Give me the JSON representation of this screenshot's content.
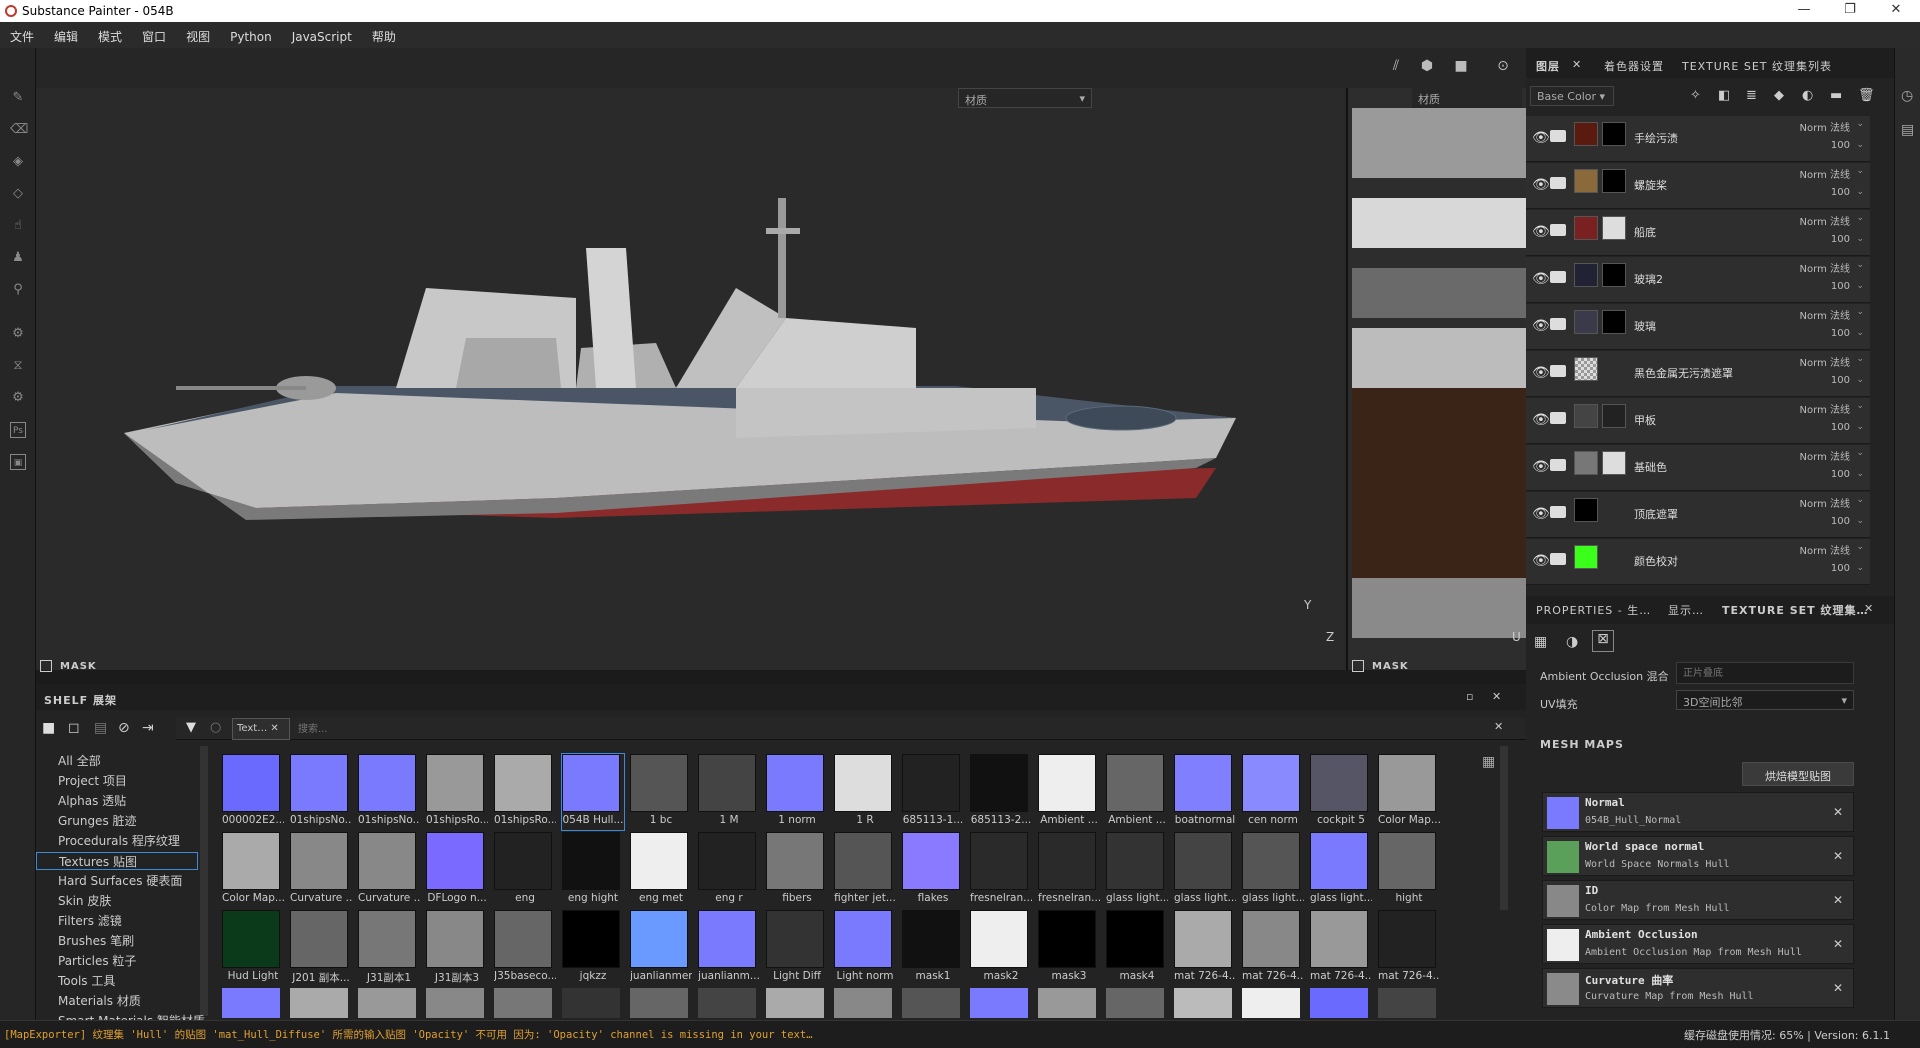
{
  "window": {
    "title": "Substance Painter - 054B"
  },
  "menu": [
    "文件",
    "编辑",
    "模式",
    "窗口",
    "视图",
    "Python",
    "JavaScript",
    "帮助"
  ],
  "viewport": {
    "material_dropdown": "材质",
    "uv_dropdown": "材质",
    "mask_label": "MASK",
    "uv_mask_label": "MASK",
    "axis_y": "Y",
    "axis_z": "Z",
    "axis_u": "U"
  },
  "tabs": {
    "layers": "图层",
    "shader": "着色器设置",
    "texset": "TEXTURE SET 纹理集列表"
  },
  "channel": "Base Color",
  "layers": [
    {
      "name": "手绘污渍",
      "blend": "Norm 法线",
      "opacity": "100",
      "thumb": "#5a1a10",
      "mask": "#000"
    },
    {
      "name": "螺旋桨",
      "blend": "Norm 法线",
      "opacity": "100",
      "thumb": "#8a6a3a",
      "mask": "#000"
    },
    {
      "name": "船底",
      "blend": "Norm 法线",
      "opacity": "100",
      "thumb": "#7a2020",
      "mask": "#ddd"
    },
    {
      "name": "玻璃2",
      "blend": "Norm 法线",
      "opacity": "100",
      "thumb": "#222235",
      "mask": "#000"
    },
    {
      "name": "玻璃",
      "blend": "Norm 法线",
      "opacity": "100",
      "thumb": "#3a3a4a",
      "mask": "#000"
    },
    {
      "name": "黑色金属无污渍遮罩",
      "blend": "Norm 法线",
      "opacity": "100",
      "thumb": "#aaa",
      "mask": "none"
    },
    {
      "name": "甲板",
      "blend": "Norm 法线",
      "opacity": "100",
      "thumb": "#444",
      "mask": "#222"
    },
    {
      "name": "基础色",
      "blend": "Norm 法线",
      "opacity": "100",
      "thumb": "#777",
      "mask": "#ddd"
    },
    {
      "name": "顶底遮罩",
      "blend": "Norm 法线",
      "opacity": "100",
      "thumb": "#000",
      "mask": "none"
    },
    {
      "name": "颜色校对",
      "blend": "Norm 法线",
      "opacity": "100",
      "thumb": "#3aff1a",
      "mask": "none"
    }
  ],
  "props": {
    "tab1": "PROPERTIES - 生…",
    "tab2": "显示…",
    "tab3": "TEXTURE SET 纹理集…",
    "ao_label": "Ambient Occlusion 混合",
    "ao_placeholder": "正片叠底",
    "uv_label": "UV填充",
    "uv_value": "3D空间比邻",
    "mesh_maps": "MESH MAPS",
    "bake_button": "烘焙模型贴图"
  },
  "mesh_maps": [
    {
      "title": "Normal",
      "sub": "054B_Hull_Normal",
      "color": "#7a7aff"
    },
    {
      "title": "World space normal",
      "sub": "World Space Normals Hull",
      "color": "#5aa05a"
    },
    {
      "title": "ID",
      "sub": "Color Map from Mesh Hull",
      "color": "#888"
    },
    {
      "title": "Ambient Occlusion",
      "sub": "Ambient Occlusion Map from Mesh Hull",
      "color": "#eee"
    },
    {
      "title": "Curvature 曲率",
      "sub": "Curvature Map from Mesh Hull",
      "color": "#8a8a8a"
    }
  ],
  "shelf": {
    "title": "SHELF 展架",
    "filter_tag": "Text…",
    "search_placeholder": "搜索...",
    "categories": [
      "All 全部",
      "Project 项目",
      "Alphas 透贴",
      "Grunges 脏迹",
      "Procedurals 程序纹理",
      "Textures 贴图",
      "Hard Surfaces 硬表面",
      "Skin 皮肤",
      "Filters 滤镜",
      "Brushes 笔刷",
      "Particles 粒子",
      "Tools 工具",
      "Materials 材质",
      "Smart Materials 智能材质"
    ],
    "selected_category": "Textures 贴图",
    "rows": [
      [
        {
          "l": "000002E2...",
          "c": "#6a6aff"
        },
        {
          "l": "01shipsNo...",
          "c": "#7a7aff"
        },
        {
          "l": "01shipsNo...",
          "c": "#7a7aff"
        },
        {
          "l": "01shipsRo...",
          "c": "#999"
        },
        {
          "l": "01shipsRo...",
          "c": "#aaa"
        },
        {
          "l": "054B Hull...",
          "c": "#7a7aff"
        },
        {
          "l": "1 bc",
          "c": "#555"
        },
        {
          "l": "1 M",
          "c": "#444"
        },
        {
          "l": "1 norm",
          "c": "#7a7aff"
        },
        {
          "l": "1 R",
          "c": "#ddd"
        },
        {
          "l": "685113-1...",
          "c": "#222"
        },
        {
          "l": "685113-2...",
          "c": "#111"
        },
        {
          "l": "Ambient ...",
          "c": "#eee"
        },
        {
          "l": "Ambient ...",
          "c": "#666"
        },
        {
          "l": "boatnormal",
          "c": "#8080ff"
        },
        {
          "l": "cen norm",
          "c": "#8a8aff"
        },
        {
          "l": "cockpit 5",
          "c": "#556"
        },
        {
          "l": "Color Map...",
          "c": "#999"
        }
      ],
      [
        {
          "l": "Color Map...",
          "c": "#aaa"
        },
        {
          "l": "Curvature ...",
          "c": "#888"
        },
        {
          "l": "Curvature ...",
          "c": "#888"
        },
        {
          "l": "DFLogo n...",
          "c": "#7a6aff"
        },
        {
          "l": "eng",
          "c": "#222"
        },
        {
          "l": "eng hight",
          "c": "#111"
        },
        {
          "l": "eng met",
          "c": "#eee"
        },
        {
          "l": "eng r",
          "c": "#222"
        },
        {
          "l": "fibers",
          "c": "#777"
        },
        {
          "l": "fighter jet...",
          "c": "#555"
        },
        {
          "l": "flakes",
          "c": "#8a7aff"
        },
        {
          "l": "fresnelran...",
          "c": "#2a2a2a"
        },
        {
          "l": "fresnelran...",
          "c": "#2a2a2a"
        },
        {
          "l": "glass light...",
          "c": "#333"
        },
        {
          "l": "glass light...",
          "c": "#444"
        },
        {
          "l": "glass light...",
          "c": "#555"
        },
        {
          "l": "glass light...",
          "c": "#7a7aff"
        },
        {
          "l": "hight",
          "c": "#666"
        }
      ],
      [
        {
          "l": "Hud Light",
          "c": "#0a3a1a"
        },
        {
          "l": "J201 副本...",
          "c": "#666"
        },
        {
          "l": "J31副本1",
          "c": "#777"
        },
        {
          "l": "J31副本3",
          "c": "#888"
        },
        {
          "l": "J35baseco...",
          "c": "#666"
        },
        {
          "l": "jqkzz",
          "c": "#000"
        },
        {
          "l": "juanlianmen",
          "c": "#6a9aff"
        },
        {
          "l": "juanlianm...",
          "c": "#7a7aff"
        },
        {
          "l": "Light Diff",
          "c": "#333"
        },
        {
          "l": "Light norm",
          "c": "#7a7aff"
        },
        {
          "l": "mask1",
          "c": "#111"
        },
        {
          "l": "mask2",
          "c": "#eee"
        },
        {
          "l": "mask3",
          "c": "#000"
        },
        {
          "l": "mask4",
          "c": "#000"
        },
        {
          "l": "mat 726-4...",
          "c": "#aaa"
        },
        {
          "l": "mat 726-4...",
          "c": "#888"
        },
        {
          "l": "mat 726-4...",
          "c": "#999"
        },
        {
          "l": "mat 726-4...",
          "c": "#222"
        }
      ]
    ]
  },
  "status": {
    "left": "[MapExporter] 纹理集 'Hull' 的贴图 'mat_Hull_Diffuse' 所需的输入贴图 'Opacity' 不可用 因为: 'Opacity' channel is missing in your text…",
    "right": "缓存磁盘使用情况:  65%  |  Version: 6.1.1"
  },
  "colors": {
    "accent": "#3d8bd8",
    "status_text": "#e0a030",
    "active_tab": "#3d8bd8"
  }
}
